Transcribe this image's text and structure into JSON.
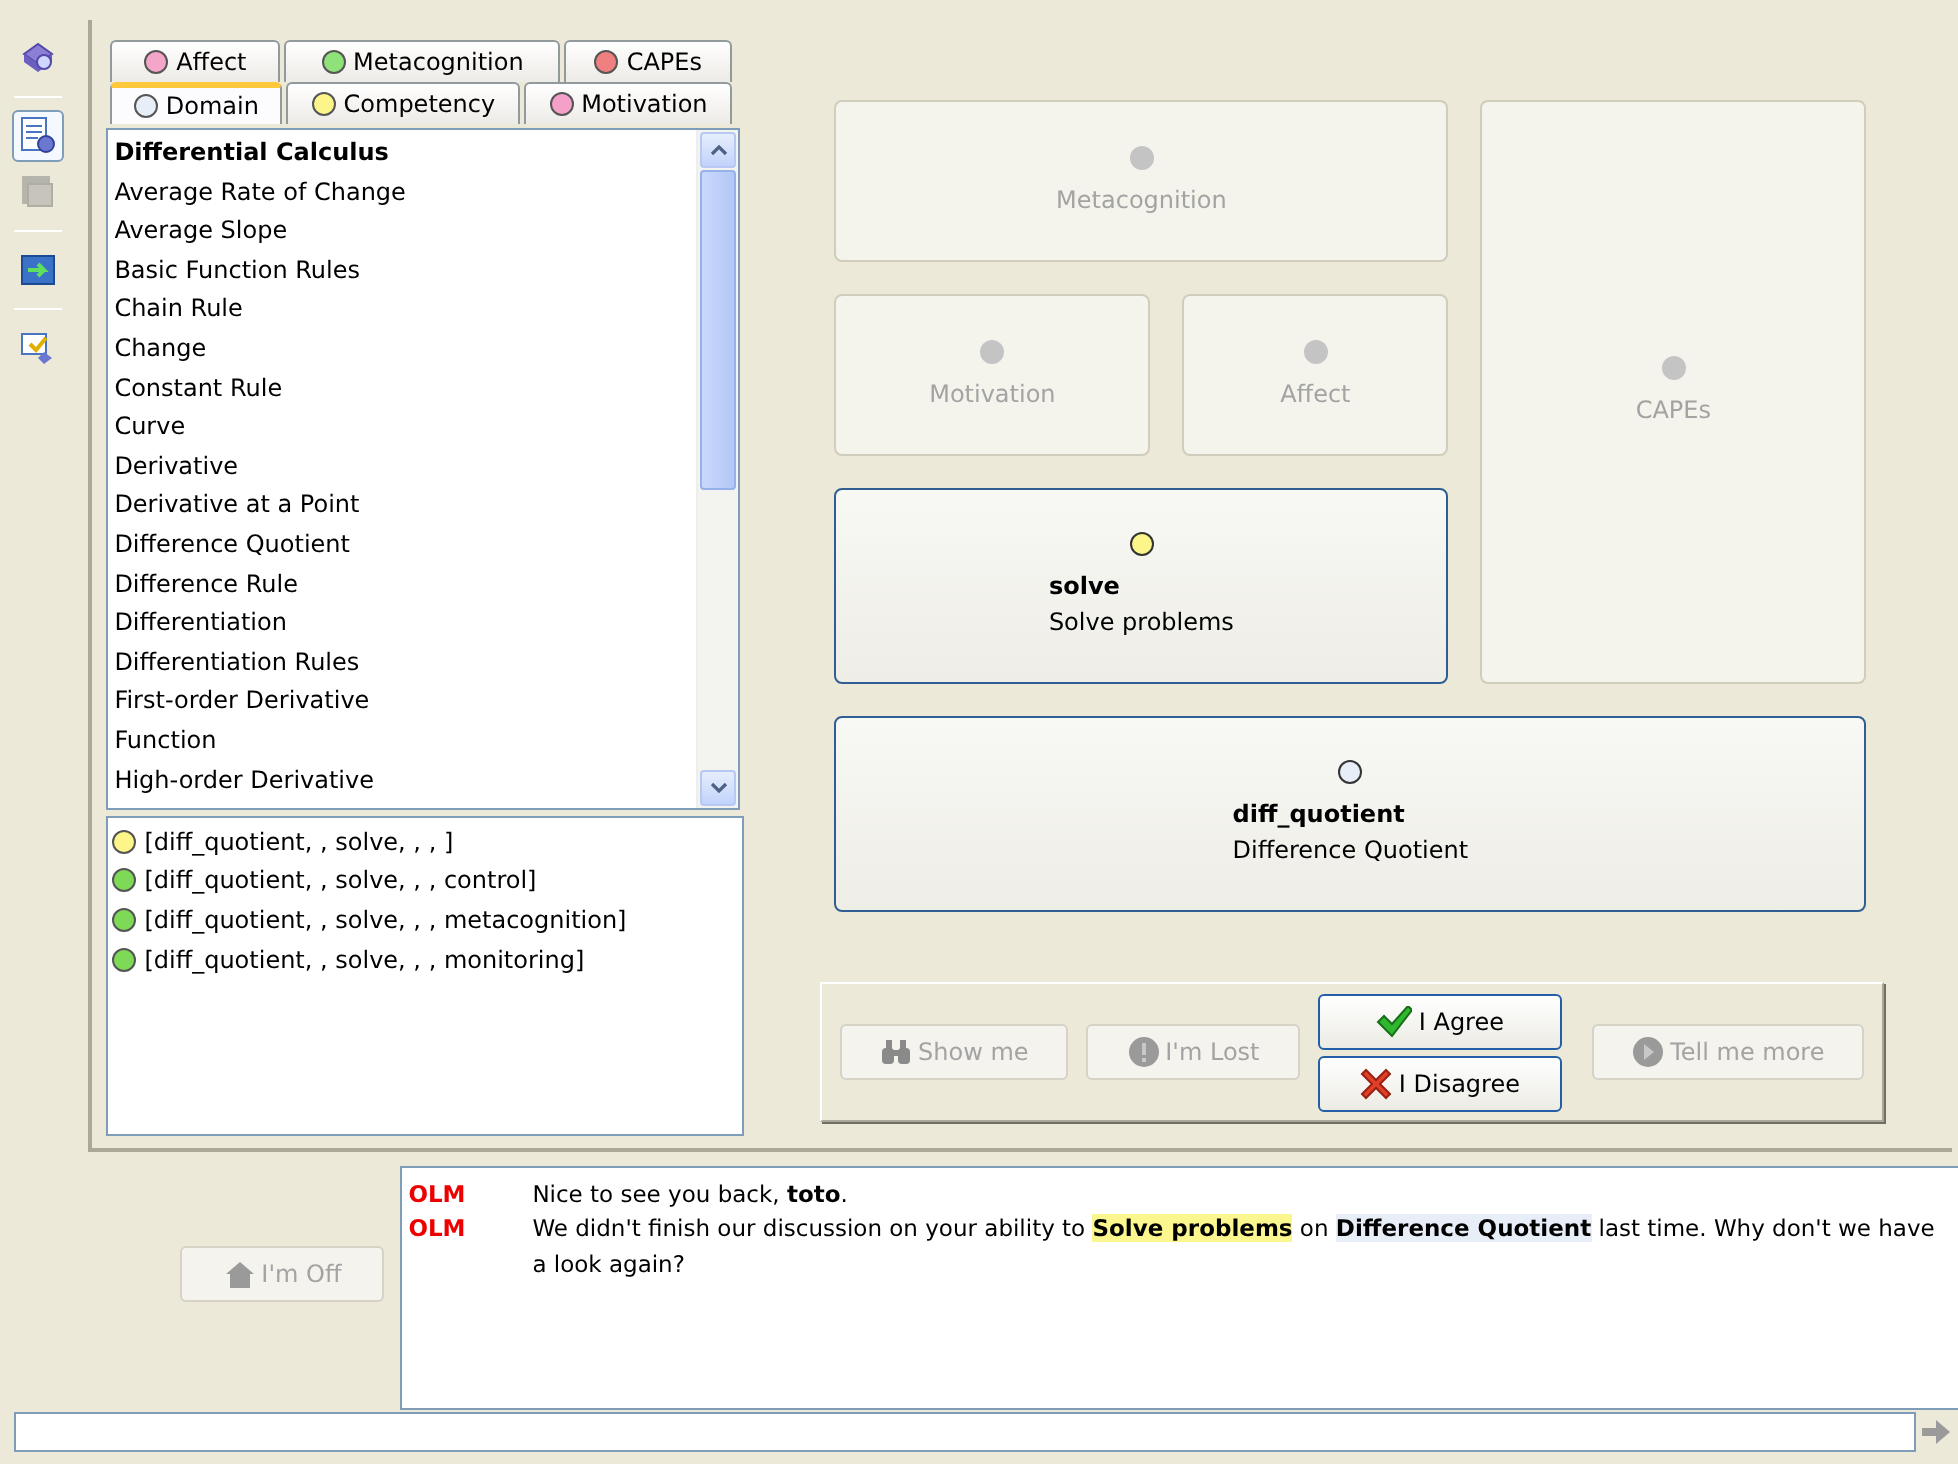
{
  "toolbar": [
    {
      "selected": false,
      "disabled": false
    },
    {
      "selected": true,
      "disabled": false
    },
    {
      "selected": false,
      "disabled": true
    },
    {
      "selected": false,
      "disabled": false
    },
    {
      "selected": false,
      "disabled": false
    }
  ],
  "tab_rows": [
    [
      {
        "label": "Affect",
        "color": "#f4a6c8",
        "selected": false
      },
      {
        "label": "Metacognition",
        "color": "#8fe27a",
        "selected": false
      },
      {
        "label": "CAPEs",
        "color": "#f08080",
        "selected": false
      }
    ],
    [
      {
        "label": "Domain",
        "color": "#e8eef8",
        "selected": true
      },
      {
        "label": "Competency",
        "color": "#fbf58a",
        "selected": false
      },
      {
        "label": "Motivation",
        "color": "#f4a0c8",
        "selected": false
      }
    ]
  ],
  "domain_list": [
    {
      "label": "Differential Calculus",
      "kind": "heading"
    },
    {
      "label": "Average Rate of Change",
      "kind": "item"
    },
    {
      "label": "Average Slope",
      "kind": "item"
    },
    {
      "label": "Basic Function Rules",
      "kind": "item"
    },
    {
      "label": "Chain Rule",
      "kind": "item"
    },
    {
      "label": "Change",
      "kind": "item"
    },
    {
      "label": "Constant Rule",
      "kind": "item"
    },
    {
      "label": "Curve",
      "kind": "item"
    },
    {
      "label": "Derivative",
      "kind": "item"
    },
    {
      "label": "Derivative at a Point",
      "kind": "item"
    },
    {
      "label": "Difference Quotient",
      "kind": "item"
    },
    {
      "label": "Difference Rule",
      "kind": "item"
    },
    {
      "label": "Differentiation",
      "kind": "item"
    },
    {
      "label": "Differentiation Rules",
      "kind": "item"
    },
    {
      "label": "First-order Derivative",
      "kind": "item"
    },
    {
      "label": "Function",
      "kind": "item"
    },
    {
      "label": "High-order Derivative",
      "kind": "item"
    }
  ],
  "beliefs": [
    {
      "label": "[diff_quotient, , solve, , , ]",
      "color": "#fbf58a"
    },
    {
      "label": "[diff_quotient, , solve, , , control]",
      "color": "#7ed957"
    },
    {
      "label": "[diff_quotient, , solve, , , metacognition]",
      "color": "#7ed957"
    },
    {
      "label": "[diff_quotient, , solve, , , monitoring]",
      "color": "#7ed957"
    }
  ],
  "nodes": [
    {
      "title": "Metacognition",
      "disabled": true,
      "color": "#c4c4c4"
    },
    {
      "title": "Motivation",
      "disabled": true,
      "color": "#c4c4c4"
    },
    {
      "title": "Affect",
      "disabled": true,
      "color": "#c4c4c4"
    },
    {
      "title": "CAPEs",
      "disabled": true,
      "color": "#c4c4c4"
    },
    {
      "title": "solve",
      "subtitle": "Solve problems",
      "disabled": false,
      "color": "#fbf58a"
    },
    {
      "title": "diff_quotient",
      "subtitle": "Difference Quotient",
      "disabled": false,
      "color": "#e8eef8"
    }
  ],
  "action_columns": [
    [
      {
        "label": "Show me",
        "kind": "show",
        "disabled": true
      }
    ],
    [
      {
        "label": "I'm Lost",
        "kind": "lost",
        "disabled": true
      }
    ],
    [
      {
        "label": "I Agree",
        "kind": "agree",
        "disabled": false
      },
      {
        "label": "I Disagree",
        "kind": "disagree",
        "disabled": false
      }
    ],
    [
      {
        "label": "Tell me more",
        "kind": "more",
        "disabled": true
      }
    ]
  ],
  "off_button": {
    "label": "I'm Off",
    "disabled": true
  },
  "chat": [
    {
      "sender": "OLM",
      "segments": [
        {
          "text": "Nice to see you back, ",
          "kind": "plain"
        },
        {
          "text": "toto",
          "kind": "bold"
        },
        {
          "text": ".",
          "kind": "plain"
        }
      ]
    },
    {
      "sender": "OLM",
      "segments": [
        {
          "text": "We didn't finish our discussion on your ability to ",
          "kind": "plain"
        },
        {
          "text": "Solve problems",
          "kind": "competency"
        },
        {
          "text": " on ",
          "kind": "plain"
        },
        {
          "text": "Difference Quotient",
          "kind": "domain"
        },
        {
          "text": " last time. Why don't we have a look again?",
          "kind": "plain"
        }
      ]
    }
  ]
}
